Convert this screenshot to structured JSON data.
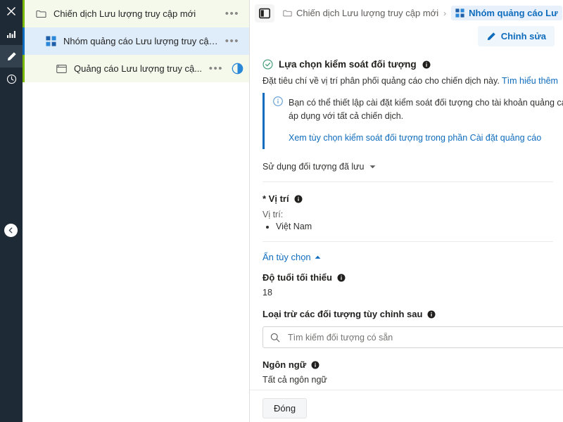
{
  "rail": {
    "icons": [
      {
        "name": "close-icon",
        "label": "Đóng"
      },
      {
        "name": "chart-icon",
        "label": "Báo cáo"
      },
      {
        "name": "pencil-icon",
        "label": "Chỉnh sửa"
      },
      {
        "name": "clock-icon",
        "label": "Lịch sử"
      }
    ],
    "collapse_label": "Thu gọn"
  },
  "tree": {
    "rows": [
      {
        "icon": "folder-icon",
        "label": "Chiến dịch Lưu lượng truy cập mới",
        "menu": "•••"
      },
      {
        "icon": "adgroup-icon",
        "label": "Nhóm quảng cáo Lưu lượng truy cập ...",
        "menu": "•••"
      },
      {
        "icon": "ad-icon",
        "label": "Quảng cáo Lưu lượng truy cậ...",
        "menu": "•••",
        "extra": "half-circle-icon"
      }
    ]
  },
  "topbar": {
    "panel_toggle": "panel-toggle-icon",
    "breadcrumb": [
      {
        "icon": "folder-icon",
        "label": "Chiến dịch Lưu lượng truy cập mới"
      },
      {
        "icon": "adgroup-icon",
        "label": "Nhóm quảng cáo Lư"
      }
    ],
    "separator": "›",
    "edit_button": "Chỉnh sửa"
  },
  "content": {
    "section_title": "Lựa chọn kiểm soát đối tượng",
    "subtitle_text": "Đặt tiêu chí về vị trí phân phối quảng cáo cho chiến dịch này.",
    "subtitle_link": "Tìm hiểu thêm",
    "info_line1": "Bạn có thể thiết lập cài đặt kiểm soát đối tượng cho tài khoản quảng cáo",
    "info_line2": "áp dụng với tất cả chiến dịch.",
    "info_link": "Xem tùy chọn kiểm soát đối tượng trong phần Cài đặt quảng cáo",
    "saved_audience": "Sử dụng đối tượng đã lưu",
    "location_label": "* Vị trí",
    "location_sub": "Vị trí:",
    "locations": [
      "Việt Nam"
    ],
    "hide_options": "Ẩn tùy chọn",
    "min_age_label": "Độ tuổi tối thiểu",
    "min_age_value": "18",
    "exclude_label": "Loại trừ các đối tượng tùy chỉnh sau",
    "exclude_placeholder": "Tìm kiếm đối tượng có sẵn",
    "exclude_value": "",
    "language_label": "Ngôn ngữ",
    "language_value": "Tất cả ngôn ngữ"
  },
  "footer": {
    "close_button": "Đóng"
  },
  "colors": {
    "rail_bg": "#1f2a37",
    "accent_blue": "#0f6cbd",
    "accent_green": "#7ab800",
    "selected_row": "#dfecf9",
    "green_row": "#f4f9ec"
  }
}
